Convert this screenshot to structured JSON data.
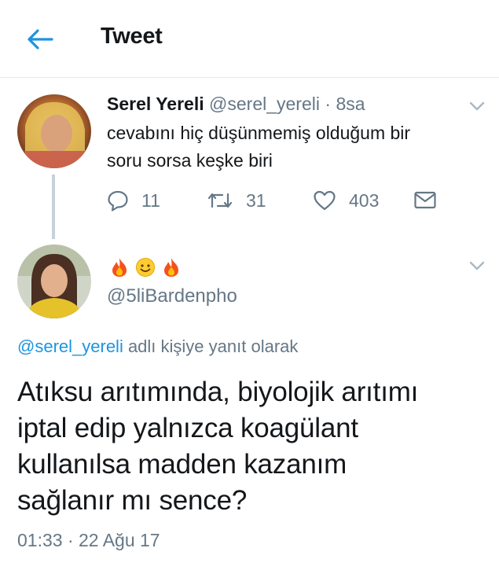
{
  "header": {
    "title": "Tweet",
    "back_icon": "back-arrow-icon"
  },
  "colors": {
    "accent": "#1b95e0",
    "muted": "#657786",
    "text": "#14171a",
    "divider": "#e1e8ed"
  },
  "parent_tweet": {
    "name": "Serel Yereli",
    "handle": "@serel_yereli",
    "separator": " · ",
    "time": "8sa",
    "text_line1": "cevabını hiç düşünmemiş olduğum bir",
    "text_line2": "soru sorsa keşke biri",
    "replies": "11",
    "retweets": "31",
    "likes": "403"
  },
  "main_tweet": {
    "display_name_emojis": [
      "fire-emoji",
      "smile-emoji",
      "fire-emoji"
    ],
    "handle": "@5liBardenpho",
    "reply_to_handle": "@serel_yereli",
    "reply_to_suffix": " adlı kişiye yanıt olarak",
    "text_line1": "Atıksu arıtımında, biyolojik arıtımı",
    "text_line2": "iptal edip yalnızca koagülant",
    "text_line3": "kullanılsa madden kazanım",
    "text_line4": "sağlanır mı sence?",
    "timestamp": "01:33 · 22 Ağu 17"
  }
}
